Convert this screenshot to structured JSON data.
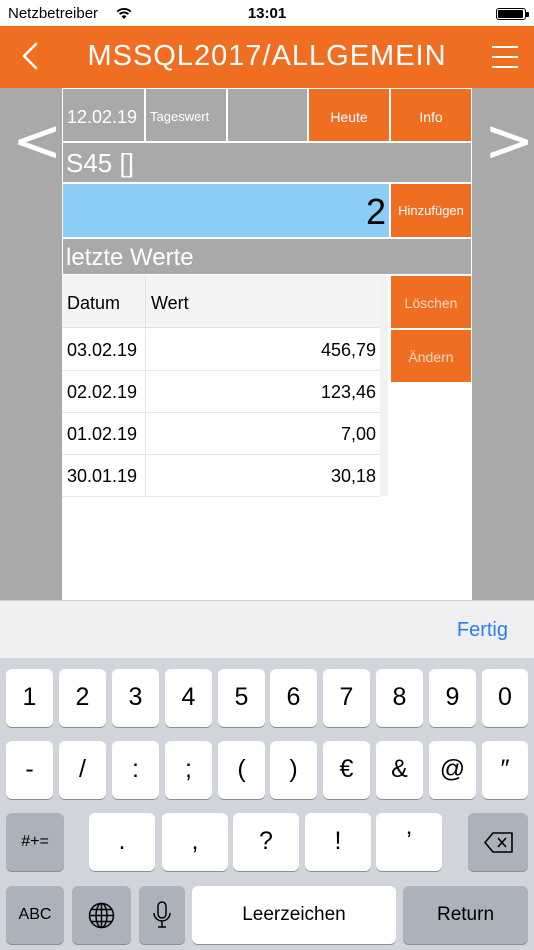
{
  "status_bar": {
    "carrier": "Netzbetreiber",
    "time": "13:01"
  },
  "nav": {
    "title": "MSSQL2017/ALLGEMEIN"
  },
  "toolbar": {
    "date": "12.02.19",
    "mode": "Tageswert",
    "empty": "",
    "today_label": "Heute",
    "info_label": "Info",
    "prev_label": "<",
    "next_label": ">"
  },
  "item": {
    "name": "S45 []"
  },
  "entry": {
    "value": "2",
    "add_label": "Hinzufügen"
  },
  "history": {
    "title": "letzte Werte",
    "columns": {
      "date": "Datum",
      "value": "Wert"
    },
    "rows": [
      {
        "date": "03.02.19",
        "value": "456,79"
      },
      {
        "date": "02.02.19",
        "value": "123,46"
      },
      {
        "date": "01.02.19",
        "value": "7,00"
      },
      {
        "date": "30.01.19",
        "value": "30,18"
      }
    ],
    "delete_label": "Löschen",
    "edit_label": "Ändern"
  },
  "keyboard": {
    "done_label": "Fertig",
    "row1": [
      "1",
      "2",
      "3",
      "4",
      "5",
      "6",
      "7",
      "8",
      "9",
      "0"
    ],
    "row2": [
      "-",
      "/",
      ":",
      ";",
      "(",
      ")",
      "€",
      "&",
      "@",
      "″"
    ],
    "row3": [
      ".",
      ",",
      "?",
      "!",
      "’"
    ],
    "symbols_label": "#+=",
    "abc_label": "ABC",
    "space_label": "Leerzeichen",
    "return_label": "Return"
  },
  "colors": {
    "accent": "#ef6e22",
    "input_bg": "#8ccdf7",
    "panel_gray": "#a9a9a9",
    "link_blue": "#2a7fe8"
  }
}
